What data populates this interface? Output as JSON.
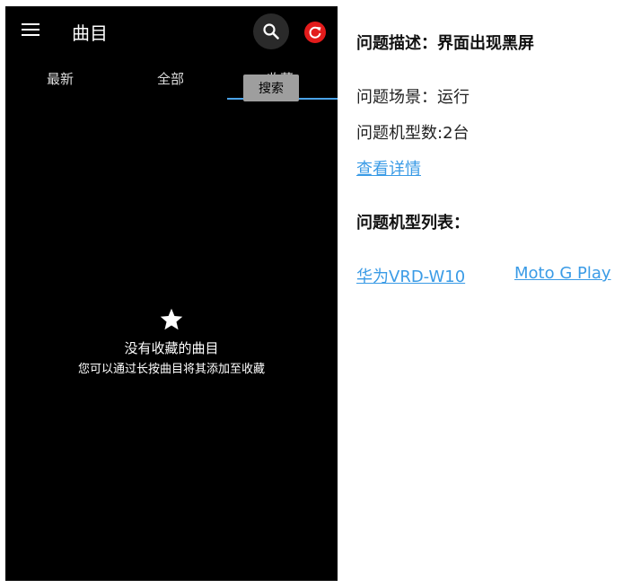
{
  "phone": {
    "title": "曲目",
    "tabs": [
      "最新",
      "全部",
      "收藏"
    ],
    "tooltip": "搜索",
    "empty_state": {
      "title": "没有收藏的曲目",
      "subtitle": "您可以通过长按曲目将其添加至收藏"
    },
    "colors": {
      "accent": "#4aa3e8",
      "refresh": "#e31b1b"
    },
    "icons": [
      "menu-icon",
      "search-icon",
      "refresh-icon",
      "star-icon"
    ]
  },
  "panel": {
    "description": "问题描述：界面出现黑屏",
    "scene": "问题场景：运行",
    "model_count": "问题机型数:2台",
    "details_link": "查看详情",
    "model_list_title": "问题机型列表：",
    "models": [
      "华为VRD-W10",
      "Moto G Play"
    ],
    "link_color": "#3a9be6"
  }
}
